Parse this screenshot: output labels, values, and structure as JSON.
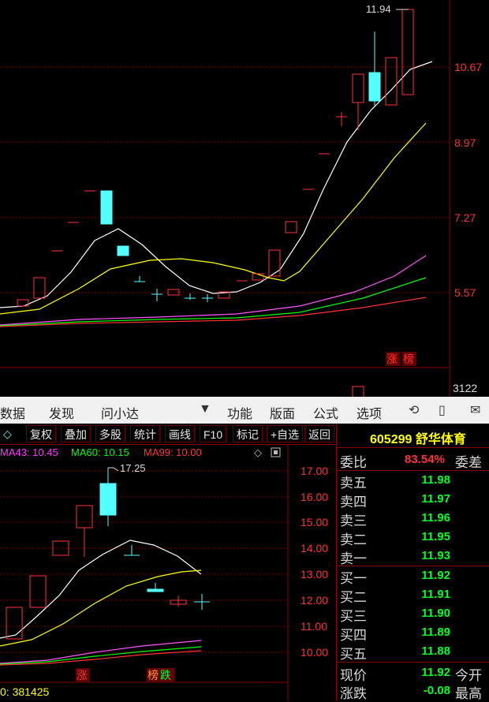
{
  "top_chart": {
    "price_labels": [
      "10.67",
      "8.97",
      "7.27",
      "5.57"
    ],
    "high_label": "11.94",
    "tags": [
      "涨",
      "榜"
    ],
    "volume_label": "3122"
  },
  "menu": {
    "items": [
      "数据",
      "发现",
      "问小达",
      "功能",
      "版面",
      "公式",
      "选项"
    ]
  },
  "toolbar": {
    "buttons": [
      "复权",
      "叠加",
      "多股",
      "统计",
      "画线",
      "F10",
      "标记",
      "+自选",
      "返回"
    ]
  },
  "ma_legend": {
    "ma43": "MA43: 10.45",
    "ma60": "MA60: 10.15",
    "ma99": "MA99: 10.00",
    "colors": {
      "ma43": "#ff33ff",
      "ma60": "#00ff00",
      "ma99": "#ff3333"
    }
  },
  "bottom_chart": {
    "price_labels": [
      "17.00",
      "16.00",
      "15.00",
      "14.00",
      "13.00",
      "12.00",
      "11.00",
      "10.00"
    ],
    "high_label": "17.25",
    "tags": [
      "涨",
      "榜",
      "跌"
    ],
    "volume_readout": "0: 381425"
  },
  "stock": {
    "code_name": "605299 舒华体育"
  },
  "order_book": {
    "ratio_label": "委比",
    "ratio_value": "83.54%",
    "diff_label": "委差",
    "asks": [
      {
        "label": "卖五",
        "price": "11.98"
      },
      {
        "label": "卖四",
        "price": "11.97"
      },
      {
        "label": "卖三",
        "price": "11.96"
      },
      {
        "label": "卖二",
        "price": "11.95"
      },
      {
        "label": "卖一",
        "price": "11.93"
      }
    ],
    "bids": [
      {
        "label": "买一",
        "price": "11.92"
      },
      {
        "label": "买二",
        "price": "11.91"
      },
      {
        "label": "买三",
        "price": "11.90"
      },
      {
        "label": "买四",
        "price": "11.89"
      },
      {
        "label": "买五",
        "price": "11.88"
      }
    ],
    "last": {
      "label": "现价",
      "value": "11.92",
      "side_label": "今开"
    },
    "change": {
      "label": "涨跌",
      "value": "-0.08",
      "side_label": "最高"
    }
  },
  "colors": {
    "up": "#ff3232",
    "down": "#54ffff",
    "grid": "#8b0000",
    "ask_bid_price": "#00ff22"
  }
}
